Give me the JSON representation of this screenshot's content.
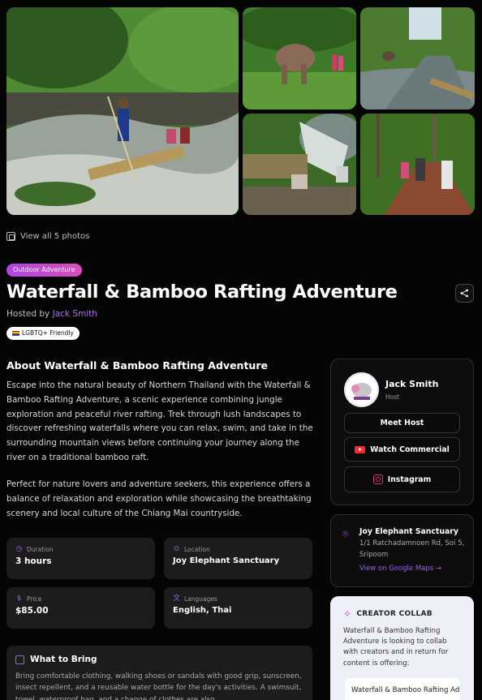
{
  "gallery": {
    "view_all_label": "View all 5 photos"
  },
  "listing": {
    "category_tag": "Outdoor Adventure",
    "title": "Waterfall & Bamboo Rafting Adventure",
    "hosted_by_prefix": "Hosted by",
    "host_name": "Jack Smith",
    "badge": "LGBTQ+ Friendly"
  },
  "about": {
    "heading": "About Waterfall & Bamboo Rafting Adventure",
    "paragraph1": "Escape into the natural beauty of Northern Thailand with the Waterfall & Bamboo Rafting Adventure, a scenic experience combining jungle exploration and peaceful river rafting. Trek through lush landscapes to discover refreshing waterfalls where you can relax, swim, and take in the surrounding mountain views before continuing your journey along the river on a traditional bamboo raft.",
    "paragraph2": "Perfect for nature lovers and adventure seekers, this experience offers a balance of relaxation and exploration while showcasing the breathtaking scenery and local culture of the Chiang Mai countryside."
  },
  "details": {
    "duration": {
      "label": "Duration",
      "value": "3 hours",
      "icon": "clock-icon"
    },
    "location": {
      "label": "Location",
      "value": "Joy Elephant Sanctuary",
      "icon": "pin-icon"
    },
    "price": {
      "label": "Price",
      "value": "$85.00",
      "icon": "dollar-icon"
    },
    "languages": {
      "label": "Languages",
      "value": "English, Thai",
      "icon": "translate-icon"
    }
  },
  "what_to_bring": {
    "title": "What to Bring",
    "text": "Bring comfortable clothing, walking shoes or sandals with good grip, sunscreen, insect repellent, and a reusable water bottle for the day's activities. A swimsuit, towel, waterproof bag, and a change of clothes are also"
  },
  "host_card": {
    "name": "Jack Smith",
    "role": "Host",
    "meet_label": "Meet Host",
    "commercial_label": "Watch Commercial",
    "instagram_label": "Instagram"
  },
  "location_card": {
    "name": "Joy Elephant Sanctuary",
    "address": "1/1 Ratchadamnoen Rd, Soi 5, Sripoom",
    "map_link": "View on Google Maps →"
  },
  "collab": {
    "title": "CREATOR COLLAB",
    "text": "Waterfall & Bamboo Rafting Adventure is looking to collab with creators and in return for content is offering:",
    "offer": "Waterfall & Bamboo Rafting Adventure for Two"
  },
  "colors": {
    "accent": "#9b5de5",
    "background": "#050505",
    "card": "#1c1c1c"
  }
}
